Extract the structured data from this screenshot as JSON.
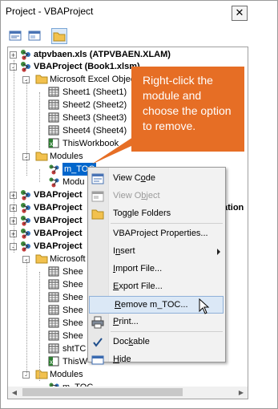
{
  "window": {
    "title": "Project - VBAProject",
    "close_glyph": "✕"
  },
  "toolbar": {
    "buttons": [
      "view-code-icon",
      "view-object-icon",
      "toggle-folders-icon"
    ]
  },
  "tree": {
    "items": [
      {
        "label": "atpvbaen.xls (ATPVBAEN.XLAM)",
        "bold": true,
        "icon": "vba-project-icon"
      },
      {
        "label": "VBAProject (Book1.xlsm)",
        "bold": true,
        "icon": "vba-project-icon"
      },
      {
        "label": "Microsoft Excel Objects",
        "icon": "folder-icon"
      },
      {
        "label": "Sheet1 (Sheet1)",
        "icon": "sheet-icon"
      },
      {
        "label": "Sheet2 (Sheet2)",
        "icon": "sheet-icon"
      },
      {
        "label": "Sheet3 (Sheet3)",
        "icon": "sheet-icon"
      },
      {
        "label": "Sheet4 (Sheet4)",
        "icon": "sheet-icon"
      },
      {
        "label": "ThisWorkbook",
        "icon": "workbook-icon"
      },
      {
        "label": "Modules",
        "icon": "folder-icon"
      },
      {
        "label": "m_TOC",
        "icon": "module-icon",
        "selected": true
      },
      {
        "label": "Modu",
        "icon": "module-icon"
      },
      {
        "label": "VBAProject",
        "bold": true,
        "icon": "vba-project-icon"
      },
      {
        "label": "VBAProject",
        "bold": true,
        "icon": "vba-project-icon",
        "suffix": "ation"
      },
      {
        "label": "VBAProject",
        "bold": true,
        "icon": "vba-project-icon"
      },
      {
        "label": "VBAProject",
        "bold": true,
        "icon": "vba-project-icon"
      },
      {
        "label": "VBAProject",
        "bold": true,
        "icon": "vba-project-icon"
      },
      {
        "label": "Microsoft",
        "icon": "folder-icon"
      },
      {
        "label": "Shee",
        "icon": "sheet-icon"
      },
      {
        "label": "Shee",
        "icon": "sheet-icon"
      },
      {
        "label": "Shee",
        "icon": "sheet-icon"
      },
      {
        "label": "Shee",
        "icon": "sheet-icon"
      },
      {
        "label": "Shee",
        "icon": "sheet-icon"
      },
      {
        "label": "Shee",
        "icon": "sheet-icon"
      },
      {
        "label": "shtTC",
        "icon": "sheet-icon"
      },
      {
        "label": "ThisW",
        "icon": "workbook-icon"
      },
      {
        "label": "Modules",
        "icon": "folder-icon"
      },
      {
        "label": "m_TOC",
        "icon": "module-icon"
      }
    ]
  },
  "callout": {
    "text": "Right-click the module and choose the option to remove."
  },
  "context_menu": {
    "items": [
      {
        "pre": "View C",
        "ul": "o",
        "post": "de",
        "icon": "view-code-icon",
        "enabled": true
      },
      {
        "pre": "View O",
        "ul": "b",
        "post": "ject",
        "icon": "view-object-icon",
        "enabled": false
      },
      {
        "pre": "Toggle Folders",
        "ul": "",
        "post": "",
        "icon": "toggle-folders-icon",
        "enabled": true
      },
      {
        "pre": "VBAProject Properties...",
        "ul": "",
        "post": "",
        "icon": "",
        "enabled": true
      },
      {
        "pre": "I",
        "ul": "n",
        "post": "sert",
        "icon": "",
        "enabled": true,
        "submenu": true
      },
      {
        "pre": "",
        "ul": "I",
        "post": "mport File...",
        "icon": "",
        "enabled": true
      },
      {
        "pre": "",
        "ul": "E",
        "post": "xport File...",
        "icon": "",
        "enabled": true
      },
      {
        "pre": "",
        "ul": "R",
        "post": "emove m_TOC...",
        "icon": "",
        "enabled": true,
        "highlighted": true
      },
      {
        "pre": "",
        "ul": "P",
        "post": "rint...",
        "icon": "print-icon",
        "enabled": true
      },
      {
        "pre": "Doc",
        "ul": "k",
        "post": "able",
        "icon": "checkmark-icon",
        "enabled": true
      },
      {
        "pre": "",
        "ul": "H",
        "post": "ide",
        "icon": "hide-icon",
        "enabled": true
      }
    ]
  },
  "colors": {
    "callout": "#e66e25",
    "selection": "#0066cc",
    "menu_highlight": "#dbe8f6"
  }
}
